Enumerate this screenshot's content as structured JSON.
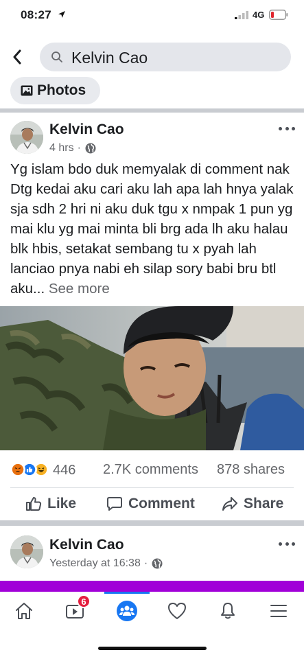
{
  "status_bar": {
    "time": "08:27",
    "network": "4G"
  },
  "search": {
    "query": "Kelvin Cao"
  },
  "filter_chip": {
    "label": "Photos"
  },
  "post": {
    "author": "Kelvin Cao",
    "time": "4 hrs",
    "separator": "·",
    "text": "Yg islam bdo duk memyalak di comment nak Dtg kedai aku cari aku lah apa lah hnya yalak sja sdh 2 hri ni aku duk tgu x nmpak 1 pun yg mai klu yg mai minta bli brg ada lh aku halau blk hbis, setakat sembang tu x pyah lah lanciao pnya nabi eh silap sory babi bru btl aku...",
    "see_more": "See more",
    "reaction_count": "446",
    "comments": "2.7K comments",
    "shares": "878 shares",
    "actions": {
      "like": "Like",
      "comment": "Comment",
      "share": "Share"
    }
  },
  "next_post": {
    "author": "Kelvin Cao",
    "time": "Yesterday at 16:38",
    "separator": "·"
  },
  "nav": {
    "video_badge": "6"
  },
  "colors": {
    "accent": "#1877f2",
    "badge": "#e41e3f",
    "purple_bar": "#a100d8"
  }
}
